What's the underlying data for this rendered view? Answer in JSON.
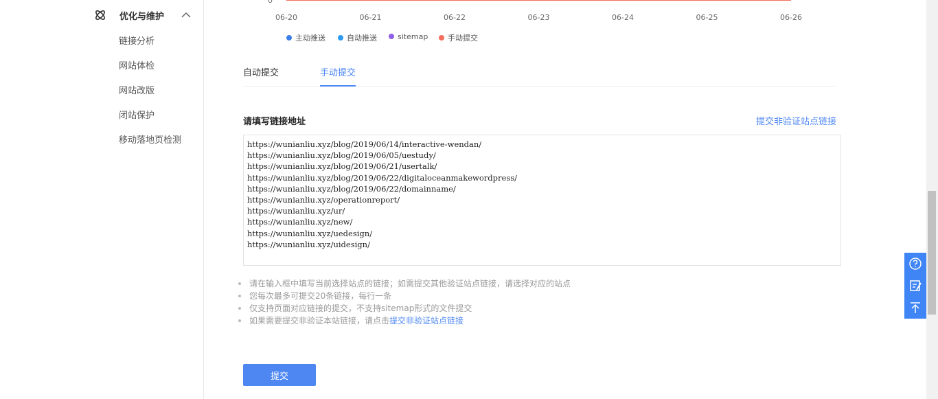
{
  "sidebar": {
    "group_label": "优化与维护",
    "items": [
      {
        "label": "链接分析"
      },
      {
        "label": "网站体检"
      },
      {
        "label": "网站改版"
      },
      {
        "label": "闭站保护"
      },
      {
        "label": "移动落地页检测"
      }
    ]
  },
  "chart_data": {
    "type": "line",
    "x": [
      "06-20",
      "06-21",
      "06-22",
      "06-23",
      "06-24",
      "06-25",
      "06-26"
    ],
    "y_tick_visible": "0",
    "series": [
      {
        "name": "主动推送",
        "color": "#3d7fe8",
        "values": [
          0,
          0,
          0,
          0,
          0,
          0,
          0
        ]
      },
      {
        "name": "自动推送",
        "color": "#2b9af3",
        "values": [
          0,
          0,
          0,
          0,
          0,
          0,
          0
        ]
      },
      {
        "name": "sitemap",
        "color": "#8e5fe3",
        "values": [
          0,
          0,
          0,
          0,
          0,
          0,
          0
        ]
      },
      {
        "name": "手动提交",
        "color": "#f26d5b",
        "values": [
          0,
          0,
          0,
          0,
          0,
          0,
          0
        ]
      }
    ]
  },
  "tabs": [
    {
      "label": "自动提交",
      "active": false
    },
    {
      "label": "手动提交",
      "active": true
    }
  ],
  "form": {
    "label": "请填写链接地址",
    "link": "提交非验证站点链接",
    "urls": "https://wunianliu.xyz/blog/2019/06/14/interactive-wendan/\nhttps://wunianliu.xyz/blog/2019/06/05/uestudy/\nhttps://wunianliu.xyz/blog/2019/06/21/usertalk/\nhttps://wunianliu.xyz/blog/2019/06/22/digitaloceanmakewordpress/\nhttps://wunianliu.xyz/blog/2019/06/22/domainname/\nhttps://wunianliu.xyz/operationreport/\nhttps://wunianliu.xyz/ur/\nhttps://wunianliu.xyz/new/\nhttps://wunianliu.xyz/uedesign/\nhttps://wunianliu.xyz/uidesign/"
  },
  "notes": {
    "n1": "请在输入框中填写当前选择站点的链接；如需提交其他验证站点链接，请选择对应的站点",
    "n2": "您每次最多可提交20条链接，每行一条",
    "n3": "仅支持页面对应链接的提交，不支持sitemap形式的文件提交",
    "n4_prefix": "如果需要提交非验证本站链接，请点击",
    "n4_link": "提交非验证站点链接"
  },
  "submit_label": "提交",
  "floatbar": {
    "icons": [
      "help-icon",
      "feedback-icon",
      "back-to-top-icon"
    ],
    "color": "#3f85f5"
  }
}
